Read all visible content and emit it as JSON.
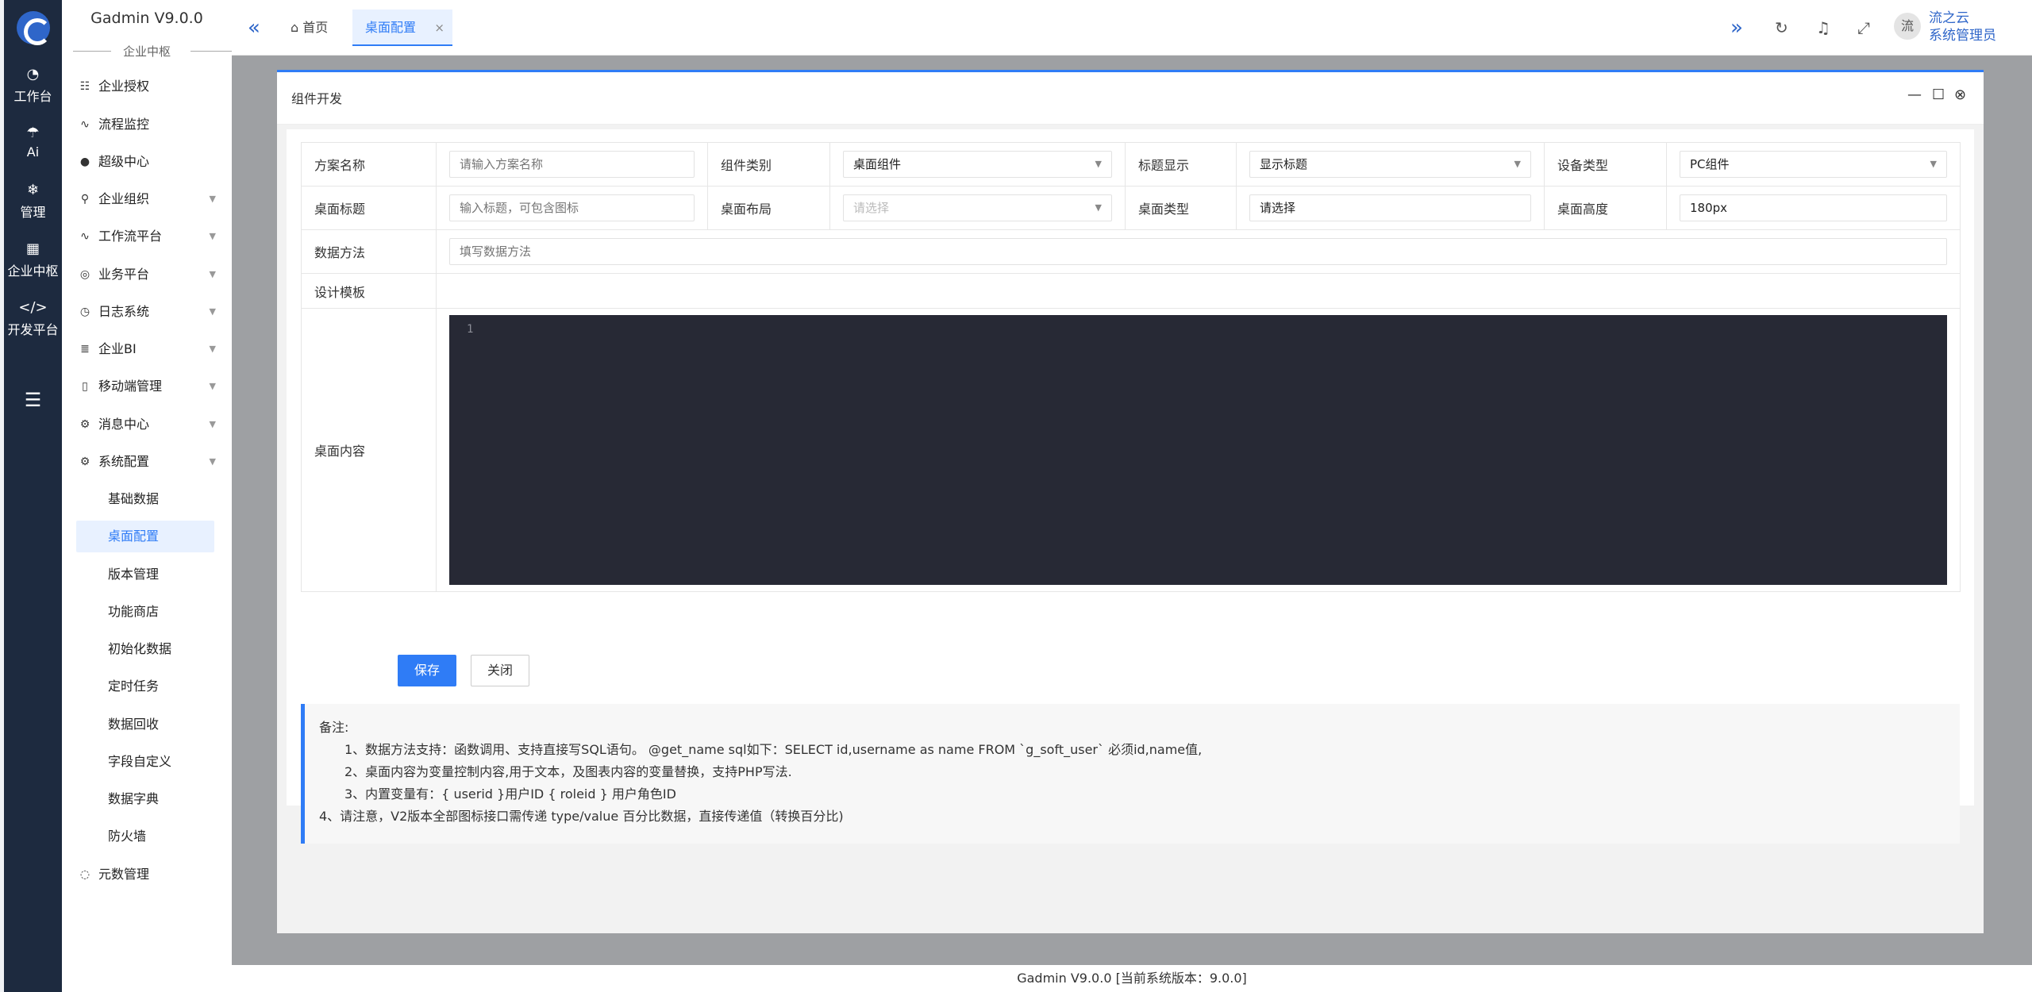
{
  "app": {
    "brand": "Gadmin V9.0.0",
    "subtitle": "企业中枢"
  },
  "rail": {
    "items": [
      {
        "label": "工作台",
        "icon": "dashboard-icon"
      },
      {
        "label": "Ai",
        "icon": "ai-icon"
      },
      {
        "label": "管理",
        "icon": "snowflake-icon"
      },
      {
        "label": "企业中枢",
        "icon": "apps-icon"
      },
      {
        "label": "开发平台",
        "icon": "code-icon"
      }
    ]
  },
  "sidebar": {
    "items": [
      {
        "label": "企业授权",
        "icon": "sliders-icon"
      },
      {
        "label": "流程监控",
        "icon": "pulse-icon"
      },
      {
        "label": "超级中心",
        "icon": "fire-icon"
      },
      {
        "label": "企业组织",
        "icon": "user-icon"
      },
      {
        "label": "工作流平台",
        "icon": "pulse-icon"
      },
      {
        "label": "业务平台",
        "icon": "compass-icon"
      },
      {
        "label": "日志系统",
        "icon": "clock-icon"
      },
      {
        "label": "企业BI",
        "icon": "layers-icon"
      },
      {
        "label": "移动端管理",
        "icon": "mobile-icon"
      },
      {
        "label": "消息中心",
        "icon": "gear-icon"
      },
      {
        "label": "系统配置",
        "icon": "gear-icon"
      }
    ],
    "sub_items": [
      "基础数据",
      "桌面配置",
      "版本管理",
      "功能商店",
      "初始化数据",
      "定时任务",
      "数据回收",
      "字段自定义",
      "数据字典",
      "防火墙"
    ],
    "last_item": "元数管理"
  },
  "header": {
    "tab_home": "首页",
    "tab_active": "桌面配置",
    "avatar_text": "流",
    "user_name": "流之云",
    "user_role": "系统管理员"
  },
  "modal": {
    "title": "组件开发",
    "form": {
      "scheme_name_label": "方案名称",
      "scheme_name_placeholder": "请输入方案名称",
      "component_type_label": "组件类别",
      "component_type_value": "桌面组件",
      "title_display_label": "标题显示",
      "title_display_value": "显示标题",
      "device_type_label": "设备类型",
      "device_type_value": "PC组件",
      "desk_title_label": "桌面标题",
      "desk_title_placeholder": "输入标题，可包含图标",
      "desk_layout_label": "桌面布局",
      "desk_layout_placeholder": "请选择",
      "desk_type_label": "桌面类型",
      "desk_type_value": "请选择",
      "desk_height_label": "桌面高度",
      "desk_height_value": "180px",
      "data_method_label": "数据方法",
      "data_method_placeholder": "填写数据方法",
      "design_template_label": "设计模板",
      "desk_content_label": "桌面内容",
      "editor_line": "1"
    },
    "buttons": {
      "save": "保存",
      "close": "关闭"
    },
    "notes": {
      "heading": "备注:",
      "lines": [
        "1、数据方法支持：函数调用、支持直接写SQL语句。 @get_name sql如下：SELECT id,username as name FROM `g_soft_user` 必须id,name值,",
        "2、桌面内容为变量控制内容,用于文本，及图表内容的变量替换，支持PHP写法.",
        "3、内置变量有：{ userid }用户ID { roleid } 用户角色ID",
        "4、请注意，V2版本全部图标接口需传递 type/value 百分比数据，直接传递值（转换百分比)"
      ]
    }
  },
  "footer": {
    "text": "Gadmin V9.0.0 [当前系统版本：9.0.0]"
  },
  "colors": {
    "accent": "#2f7cf6",
    "rail_bg": "#1d2a3f",
    "editor_bg": "#272935"
  }
}
